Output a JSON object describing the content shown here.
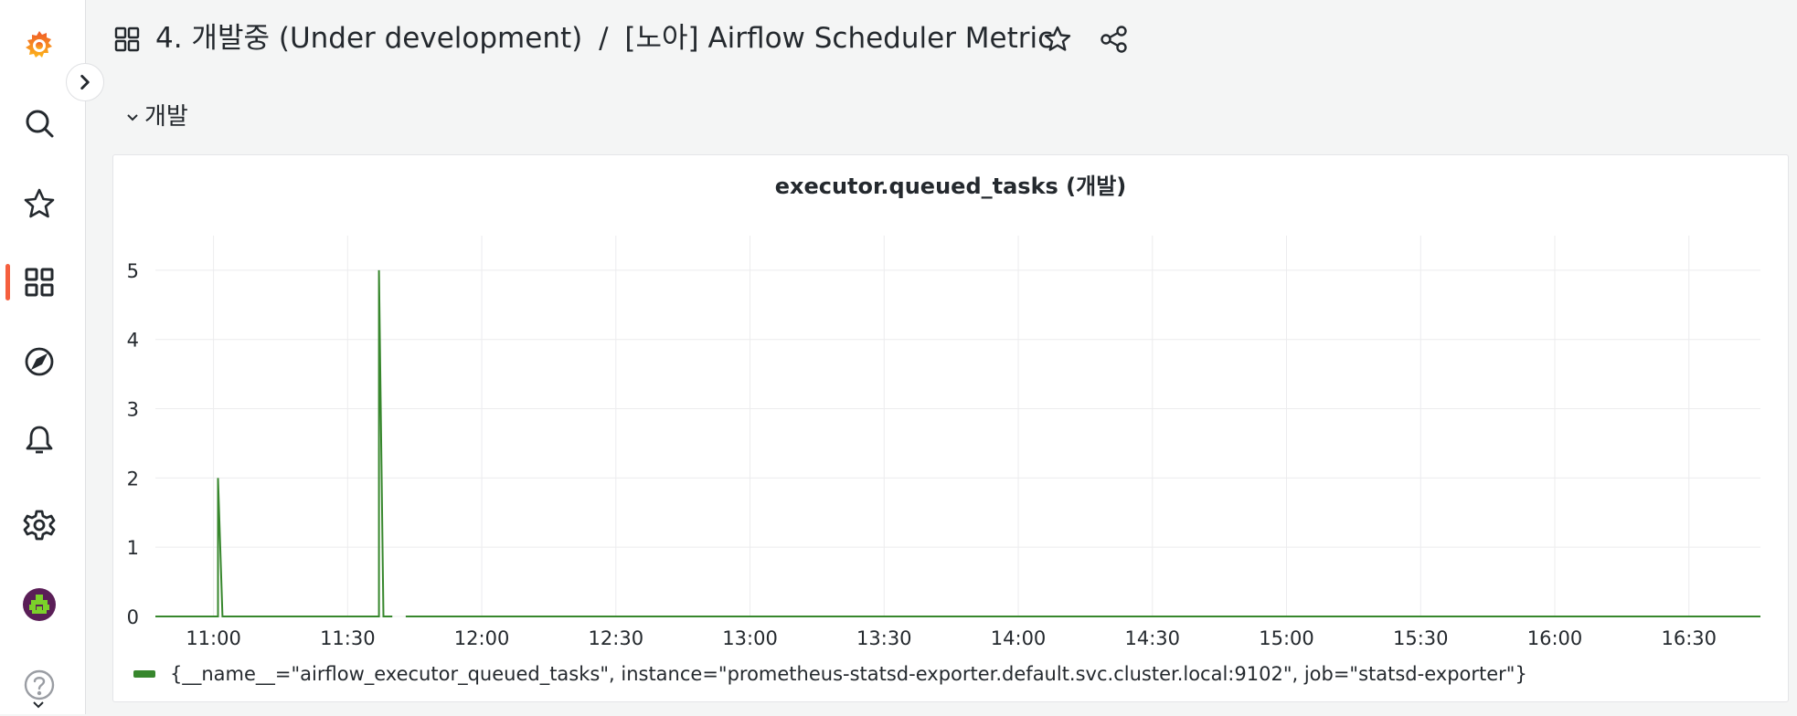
{
  "breadcrumb": {
    "folder": "4. 개발중 (Under development)",
    "separator": "/",
    "dashboard": "[노아] Airflow Scheduler Metric"
  },
  "row": {
    "title": "개발"
  },
  "panel": {
    "title": "executor.queued_tasks (개발)",
    "legend": "{__name__=\"airflow_executor_queued_tasks\", instance=\"prometheus-statsd-exporter.default.svc.cluster.local:9102\", job=\"statsd-exporter\"}"
  },
  "chart_data": {
    "type": "line",
    "title": "executor.queued_tasks (개발)",
    "xlabel": "",
    "ylabel": "",
    "x_ticks": [
      "11:00",
      "11:30",
      "12:00",
      "12:30",
      "13:00",
      "13:30",
      "14:00",
      "14:30",
      "15:00",
      "15:30",
      "16:00",
      "16:30"
    ],
    "y_ticks": [
      0,
      1,
      2,
      3,
      4,
      5
    ],
    "xlim": [
      "10:47",
      "16:46"
    ],
    "ylim": [
      0,
      5.5
    ],
    "grid": true,
    "legend_position": "bottom-left",
    "series": [
      {
        "name": "{__name__=\"airflow_executor_queued_tasks\", instance=\"prometheus-statsd-exporter.default.svc.cluster.local:9102\", job=\"statsd-exporter\"}",
        "color": "#37872d",
        "segments": [
          [
            [
              "10:47",
              0
            ],
            [
              "11:01",
              0
            ],
            [
              "11:01",
              2
            ],
            [
              "11:02",
              0
            ],
            [
              "11:37",
              0
            ],
            [
              "11:37",
              5
            ],
            [
              "11:38",
              0
            ],
            [
              "11:40",
              0
            ]
          ],
          [
            [
              "11:43",
              0
            ],
            [
              "16:46",
              0
            ]
          ]
        ]
      }
    ]
  },
  "colors": {
    "accent": "#f55f3e",
    "series": "#37872d"
  },
  "icons": {
    "sidebar": [
      "grafana-logo-icon",
      "search-icon",
      "star-icon",
      "dashboards-icon",
      "explore-icon",
      "alerting-icon",
      "settings-icon",
      "user-avatar-icon",
      "help-icon"
    ],
    "breadcrumb": "dashboards-icon",
    "actions": [
      "star-icon",
      "share-icon"
    ]
  }
}
